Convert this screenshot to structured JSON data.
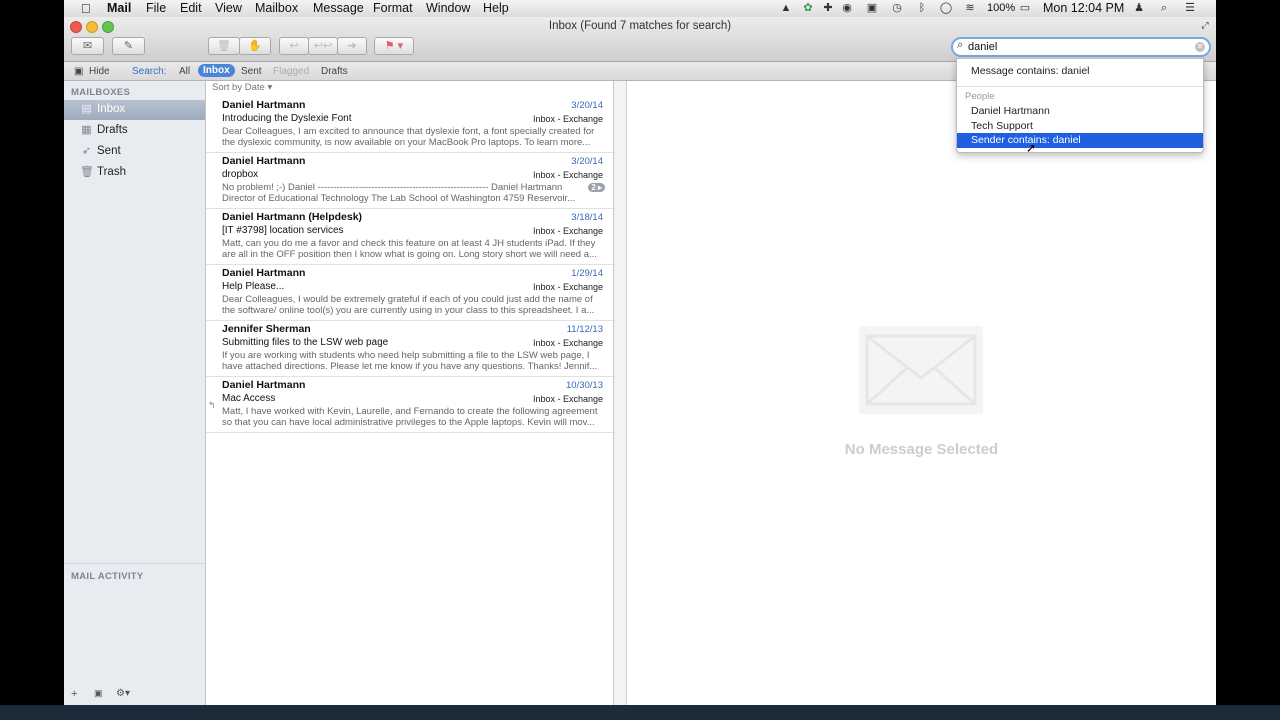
{
  "menubar": {
    "app": "Mail",
    "items": [
      "File",
      "Edit",
      "View",
      "Mailbox",
      "Message",
      "Format",
      "Window",
      "Help"
    ],
    "battery": "100%",
    "clock": "Mon 12:04 PM"
  },
  "window": {
    "title": "Inbox (Found 7 matches for search)"
  },
  "toolbar": {
    "get_mail_icon": "envelope-icon",
    "compose_icon": "compose-icon"
  },
  "search": {
    "value": "daniel"
  },
  "scopebar": {
    "hide": "Hide",
    "search_label": "Search:",
    "scopes": [
      "All",
      "Inbox",
      "Sent",
      "Flagged",
      "Drafts"
    ],
    "selected": "Inbox"
  },
  "sidebar": {
    "heading": "MAILBOXES",
    "items": [
      {
        "label": "Inbox",
        "icon": "inbox-icon"
      },
      {
        "label": "Drafts",
        "icon": "drafts-icon"
      },
      {
        "label": "Sent",
        "icon": "sent-icon"
      },
      {
        "label": "Trash",
        "icon": "trash-icon"
      }
    ],
    "activity_heading": "MAIL ACTIVITY",
    "footer": [
      "+",
      "▣",
      "⚙▾"
    ]
  },
  "list": {
    "sort_label": "Sort by Date ▾",
    "messages": [
      {
        "from": "Daniel Hartmann",
        "date": "3/20/14",
        "subject": "Introducing the Dyslexie Font",
        "mailbox": "Inbox - Exchange",
        "preview": "Dear Colleagues, I am excited to announce that dyslexie font, a font specially created for the dyslexic community, is now available on your MacBook Pro laptops. To learn more..."
      },
      {
        "from": "Daniel Hartmann",
        "date": "3/20/14",
        "subject": "dropbox",
        "mailbox": "Inbox - Exchange",
        "preview": "No problem! ;-) Daniel ------------------------------------------------------ Daniel Hartmann Director of Educational Technology The Lab School of Washington 4759 Reservoir...",
        "badge": "2 ▸"
      },
      {
        "from": "Daniel Hartmann (Helpdesk)",
        "date": "3/18/14",
        "subject": "[IT #3798] location services",
        "mailbox": "Inbox - Exchange",
        "preview": "Matt, can you do me a favor and check this feature on at least 4 JH students iPad. If they are all in the OFF position then I know what is going on. Long story short we will need a..."
      },
      {
        "from": "Daniel Hartmann",
        "date": "1/29/14",
        "subject": "Help Please...",
        "mailbox": "Inbox - Exchange",
        "preview": "Dear Colleagues, I would be extremely grateful if each of you could just add the name of the software/ online tool(s) you are currently using in your class to this spreadsheet. I a..."
      },
      {
        "from": "Jennifer Sherman",
        "date": "11/12/13",
        "subject": "Submitting files to the LSW web page",
        "mailbox": "Inbox - Exchange",
        "preview": "If you are working with students who need help submitting a file to the LSW web page, I have attached directions. Please let me know if you have any questions. Thanks! Jennif..."
      },
      {
        "from": "Daniel Hartmann",
        "date": "10/30/13",
        "subject": "Mac Access",
        "mailbox": "Inbox - Exchange",
        "preview": "Matt, I have worked with Kevin, Laurelle, and Fernando to create the following agreement so that you can have local administrative privileges to the Apple laptops. Kevin will mov...",
        "replied": "↰"
      }
    ]
  },
  "viewer": {
    "empty_text": "No Message Selected"
  },
  "suggestions": {
    "message_contains": "Message contains: daniel",
    "people_heading": "People",
    "people": [
      "Daniel Hartmann",
      "Tech Support"
    ],
    "selected": "Sender contains: daniel"
  },
  "colors": {
    "accent": "#1f5fe0",
    "scope_selected": "#4b86d6",
    "date": "#3668b8"
  }
}
